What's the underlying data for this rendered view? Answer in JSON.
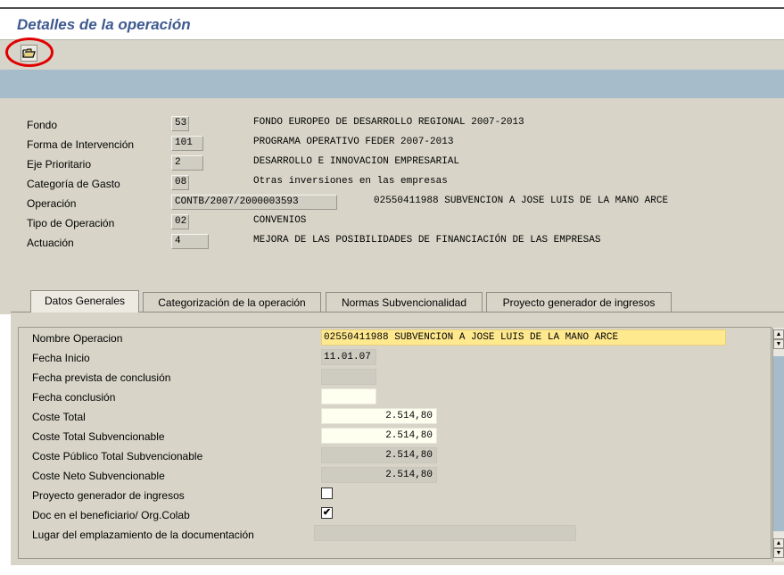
{
  "title": "Detalles de la operación",
  "toolbar": {
    "open_icon": "folder-open-icon"
  },
  "header": {
    "rows": [
      {
        "label": "Fondo",
        "code": "53",
        "desc": "FONDO EUROPEO DE DESARROLLO REGIONAL  2007-2013"
      },
      {
        "label": "Forma de Intervención",
        "code": "101",
        "desc": "PROGRAMA OPERATIVO FEDER 2007-2013"
      },
      {
        "label": "Eje Prioritario",
        "code": "2",
        "desc": "DESARROLLO E INNOVACION EMPRESARIAL"
      },
      {
        "label": "Categoría de Gasto",
        "code": "08",
        "desc": "Otras inversiones en las empresas"
      },
      {
        "label": "Operación",
        "code": "CONTB/2007/2000003593",
        "desc": "02550411988 SUBVENCION A JOSE LUIS DE LA MANO ARCE"
      },
      {
        "label": "Tipo de Operación",
        "code": "02",
        "desc": "CONVENIOS"
      },
      {
        "label": "Actuación",
        "code": "4",
        "desc": "MEJORA DE LAS POSIBILIDADES DE FINANCIACIÓN DE LAS EMPRESAS"
      }
    ]
  },
  "tabs": [
    "Datos Generales",
    "Categorización de la operación",
    "Normas Subvencionalidad",
    "Proyecto generador de ingresos"
  ],
  "fields": {
    "nombre": {
      "label": "Nombre Operacion",
      "value": "02550411988 SUBVENCION A JOSE LUIS DE LA MANO ARCE"
    },
    "fecha_inicio": {
      "label": "Fecha Inicio",
      "value": "11.01.07"
    },
    "fecha_prevista": {
      "label": "Fecha prevista de conclusión",
      "value": ""
    },
    "fecha_conclusion": {
      "label": "Fecha conclusión",
      "value": ""
    },
    "coste_total": {
      "label": "Coste Total",
      "value": "2.514,80"
    },
    "coste_total_subv": {
      "label": "Coste Total Subvencionable",
      "value": "2.514,80"
    },
    "coste_publico": {
      "label": "Coste Público Total Subvencionable",
      "value": "2.514,80"
    },
    "coste_neto": {
      "label": "Coste Neto Subvencionable",
      "value": "2.514,80"
    },
    "proyecto": {
      "label": "Proyecto generador de ingresos",
      "checked": false
    },
    "doc_benef": {
      "label": "Doc en el beneficiario/ Org.Colab",
      "checked": true,
      "mark": "✔"
    },
    "lugar": {
      "label": "Lugar del emplazamiento de la documentación",
      "value": ""
    }
  },
  "colors": {
    "title": "#3f5a8f",
    "highlight": "#ffe98f",
    "band": "#a6bccb",
    "circle": "#e00000"
  }
}
